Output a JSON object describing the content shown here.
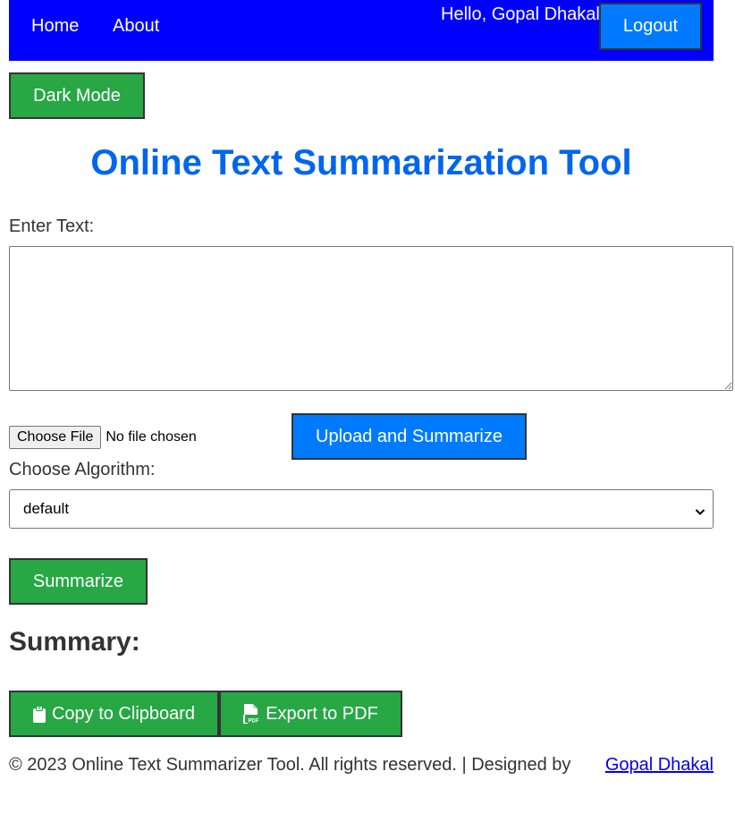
{
  "nav": {
    "home_label": "Home",
    "about_label": "About",
    "greeting": "Hello, Gopal Dhakal",
    "logout_label": "Logout"
  },
  "dark_mode_label": "Dark Mode",
  "page_title": "Online Text Summarization Tool",
  "input": {
    "label": "Enter Text:",
    "value": ""
  },
  "file": {
    "choose_label": "Choose File",
    "status": "No file chosen",
    "upload_label": "Upload and Summarize"
  },
  "algorithm": {
    "label": "Choose Algorithm:",
    "selected": "default"
  },
  "summarize_label": "Summarize",
  "summary_heading": "Summary:",
  "actions": {
    "copy_label": "Copy to Clipboard",
    "copy_icon": "clipboard-icon",
    "pdf_label": "Export to PDF",
    "pdf_icon": "file-pdf-icon"
  },
  "footer": {
    "text": "© 2023 Online Text Summarizer Tool. All rights reserved. | Designed by",
    "link": "Gopal Dhakal"
  },
  "colors": {
    "navbar": "#0000ff",
    "primary_button": "#007bff",
    "success_button": "#28a745",
    "title": "#0066ee",
    "link": "#0000ee"
  }
}
